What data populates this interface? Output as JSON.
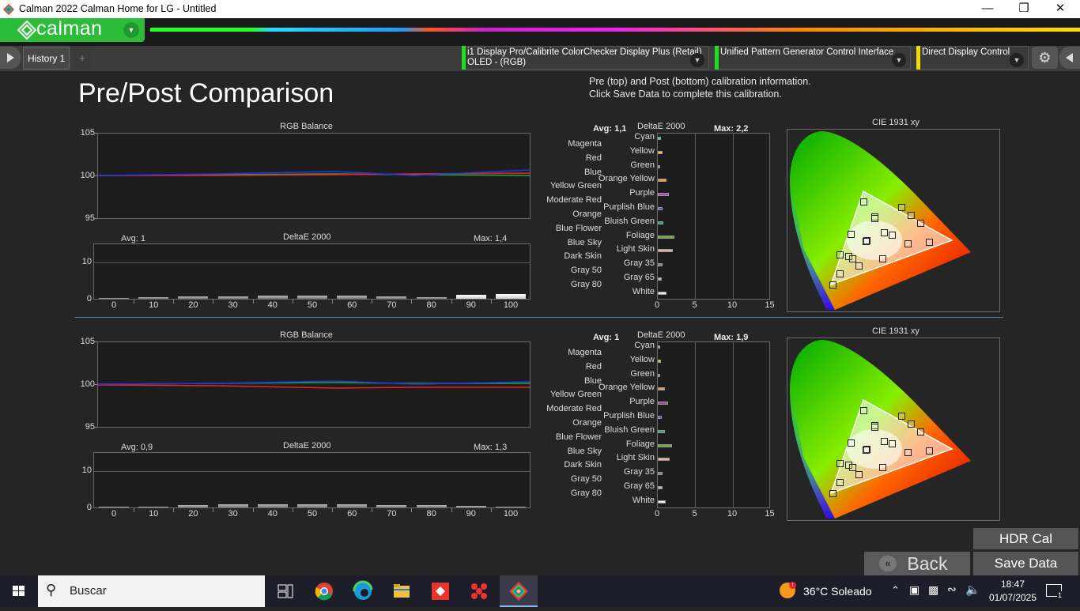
{
  "window": {
    "title": "Calman 2022 Calman Home for LG  - Untitled"
  },
  "brand": {
    "logo_text": "calman",
    "green": "#2bbd3a"
  },
  "tabs": [
    {
      "label": "History 1"
    },
    {
      "label": "+"
    }
  ],
  "devices": [
    {
      "line1": "i1 Display Pro/Calibrite ColorChecker Display Plus (Retail)",
      "line2": "OLED - (RGB)",
      "color": "#22dd22"
    },
    {
      "line1": "Unified Pattern Generator Control Interface",
      "line2": "",
      "color": "#22dd22"
    },
    {
      "line1": "Direct Display Control",
      "line2": "",
      "color": "#eedd00"
    }
  ],
  "page": {
    "title": "Pre/Post Comparison",
    "info_line1": "Pre (top) and Post (bottom) calibration information.",
    "info_line2": "Click Save Data to complete this calibration."
  },
  "pre": {
    "rgb_title": "RGB Balance",
    "rgb_yticks": [
      "105",
      "100",
      "95"
    ],
    "de_title": "DeltaE 2000",
    "de_avg": "Avg: 1",
    "de_max": "Max: 1,4",
    "de_yticks": [
      "10",
      "0"
    ],
    "de_xticks": [
      "0",
      "10",
      "20",
      "30",
      "40",
      "50",
      "60",
      "70",
      "80",
      "90",
      "100"
    ],
    "gray_de": [
      0.1,
      0.4,
      0.6,
      0.7,
      1.0,
      1.0,
      0.8,
      0.6,
      0.5,
      1.2,
      1.4
    ],
    "color_avg": "Avg: 1,1",
    "color_title": "DeltaE 2000",
    "color_max": "Max: 2,2",
    "cie_title": "CIE 1931 xy"
  },
  "post": {
    "rgb_title": "RGB Balance",
    "rgb_yticks": [
      "105",
      "100",
      "95"
    ],
    "de_title": "DeltaE 2000",
    "de_avg": "Avg: 0,9",
    "de_max": "Max: 1,3",
    "de_yticks": [
      "10",
      "0"
    ],
    "de_xticks": [
      "0",
      "10",
      "20",
      "30",
      "40",
      "50",
      "60",
      "70",
      "80",
      "90",
      "100"
    ],
    "gray_de": [
      0.1,
      0.2,
      0.6,
      0.8,
      1.0,
      0.9,
      0.8,
      0.7,
      0.6,
      0.4,
      0.3
    ],
    "color_avg": "Avg: 1",
    "color_title": "DeltaE 2000",
    "color_max": "Max: 1,9",
    "cie_title": "CIE 1931 xy"
  },
  "color_labels_left": [
    "Magenta",
    "Red",
    "Blue",
    "Yellow Green",
    "Moderate Red",
    "Orange",
    "Blue Flower",
    "Blue Sky",
    "Dark Skin",
    "Gray 50",
    "Gray 80"
  ],
  "color_labels_right": [
    "Cyan",
    "Yellow",
    "Green",
    "Orange Yellow",
    "Purple",
    "Purplish Blue",
    "Bluish Green",
    "Foliage",
    "Light Skin",
    "Gray 35",
    "Gray 65",
    "White"
  ],
  "color_xticks": [
    "0",
    "5",
    "10",
    "15"
  ],
  "buttons": {
    "hdr": "HDR Cal",
    "back": "Back",
    "save": "Save Data"
  },
  "taskbar": {
    "search": "Buscar",
    "weather": "36°C  Soleado",
    "time": "18:47",
    "date": "01/07/2025",
    "notif_count": "1"
  }
}
